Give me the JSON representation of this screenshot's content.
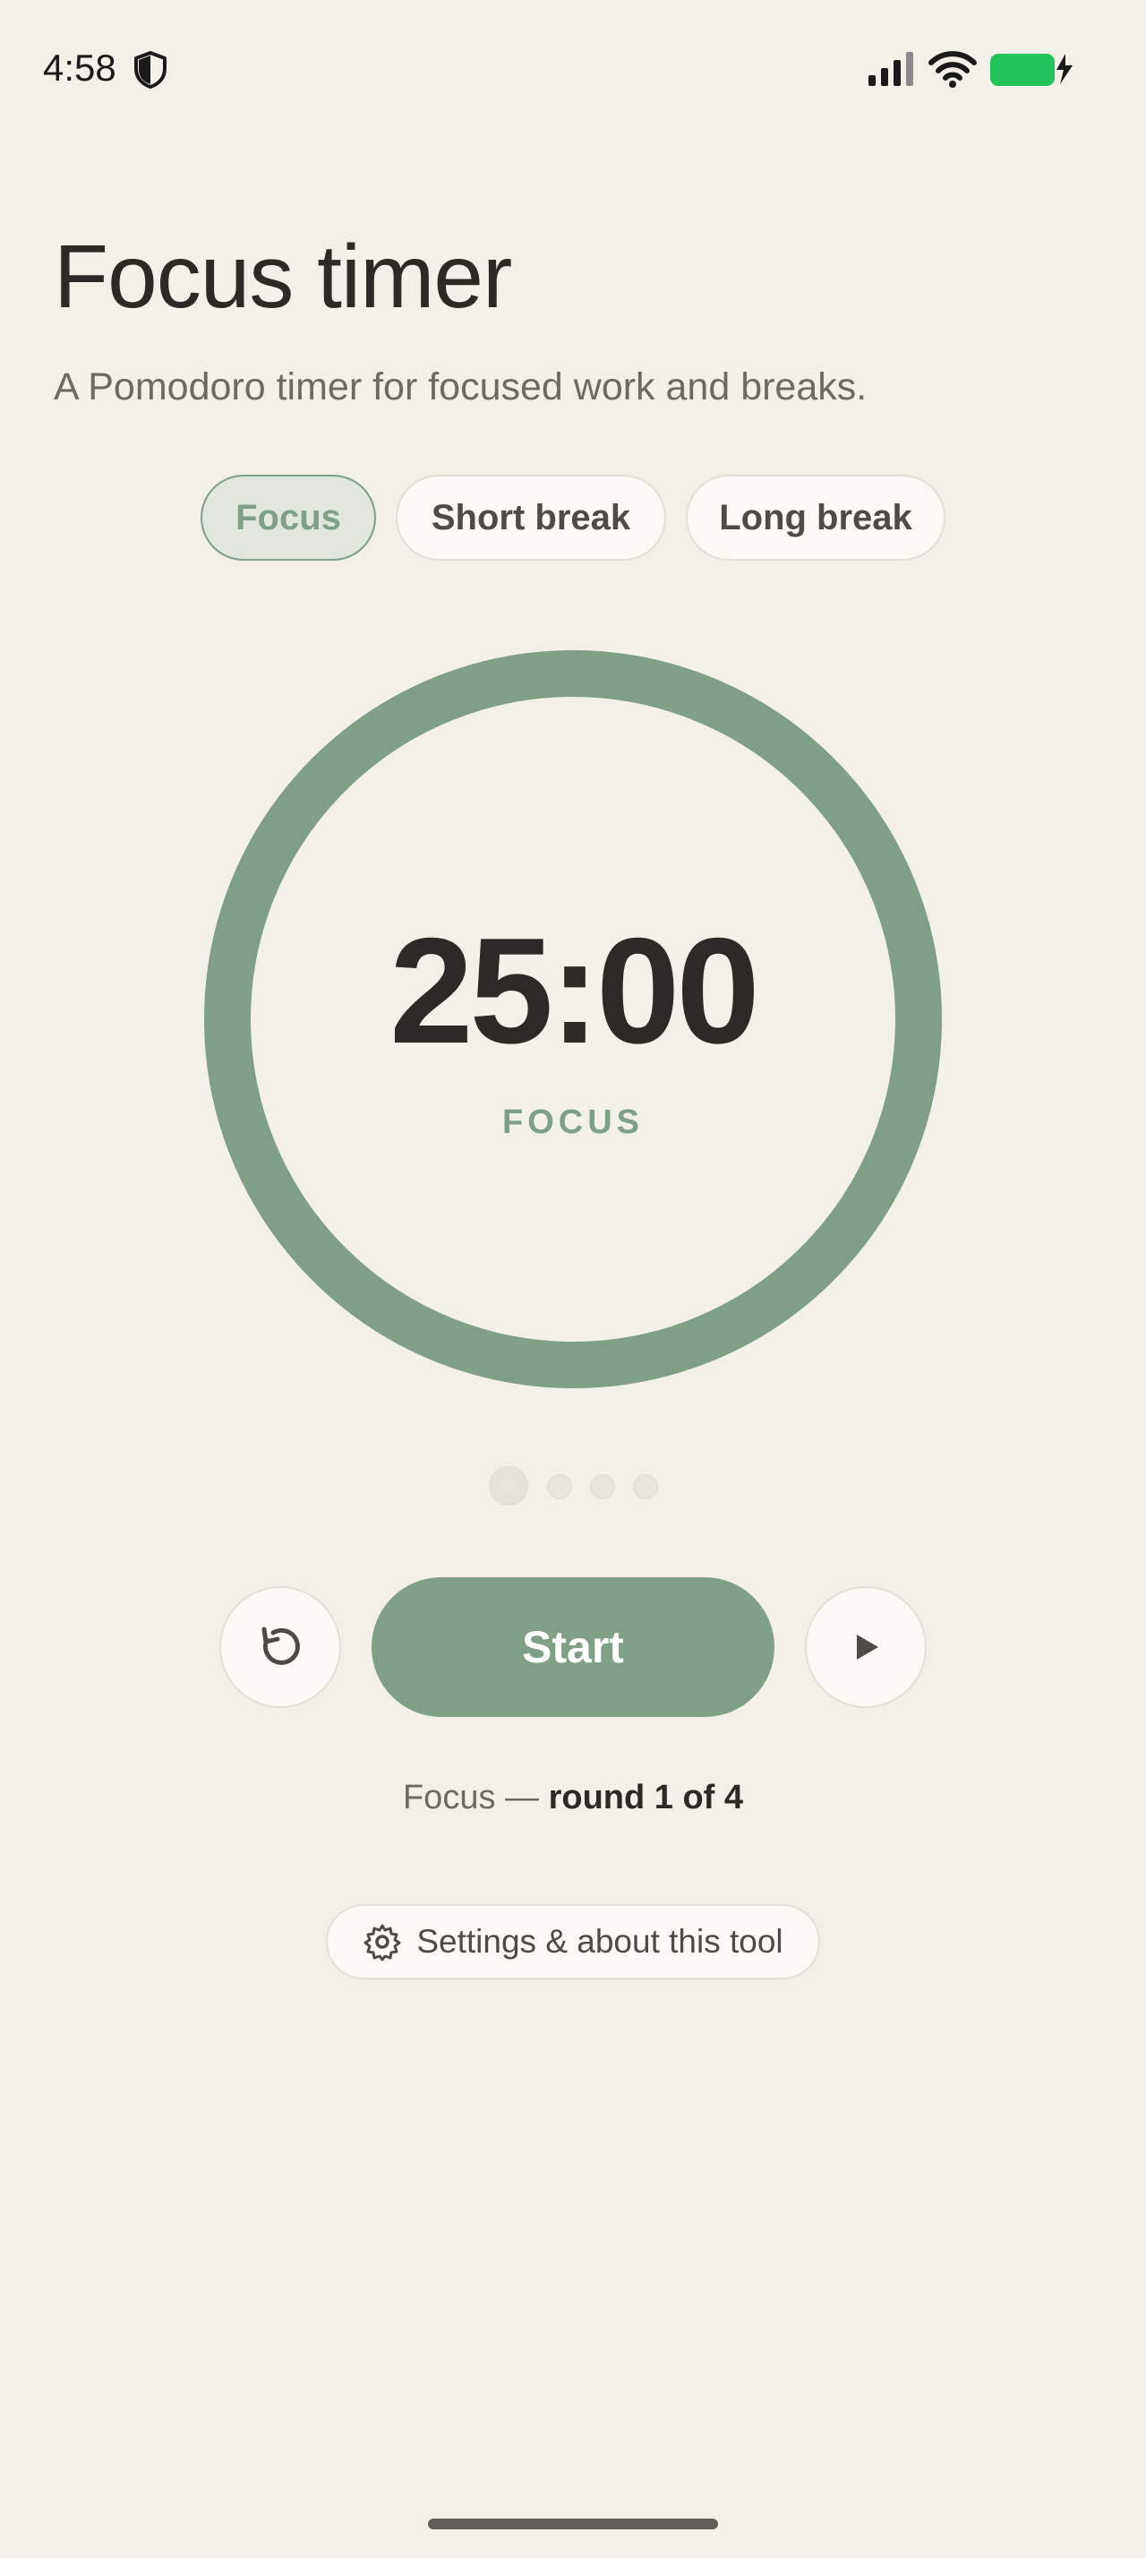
{
  "status_bar": {
    "time": "4:58",
    "icons": [
      "shield-icon",
      "cellular-signal-icon",
      "wifi-icon",
      "battery-charging-icon"
    ],
    "battery_color": "#21c35a"
  },
  "header": {
    "title": "Focus timer",
    "subtitle": "A Pomodoro timer for focused work and breaks."
  },
  "tabs": [
    {
      "label": "Focus",
      "active": true
    },
    {
      "label": "Short break",
      "active": false
    },
    {
      "label": "Long break",
      "active": false
    }
  ],
  "timer": {
    "time": "25:00",
    "mode_label": "FOCUS",
    "progress": 1.0
  },
  "rounds": {
    "total": 4,
    "current": 1
  },
  "controls": {
    "reset_icon": "reset-icon",
    "start_label": "Start",
    "skip_icon": "play-skip-icon"
  },
  "round_line": {
    "prefix": "Focus — ",
    "emphasis": "round 1 of 4"
  },
  "settings": {
    "icon": "gear-icon",
    "label": "Settings & about this tool"
  },
  "colors": {
    "accent": "#7f9f86",
    "background": "#f3f0ea",
    "text": "#2b2a26",
    "muted_text": "#6b6a63"
  }
}
